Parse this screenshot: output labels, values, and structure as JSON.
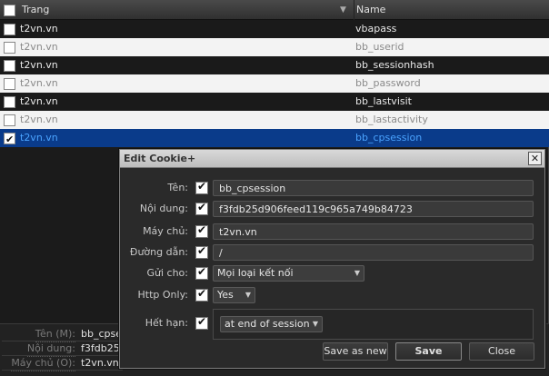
{
  "table": {
    "col_host": "Trang",
    "col_name": "Name",
    "sort_icon": "triangle-down",
    "rows": [
      {
        "host": "t2vn.vn",
        "name": "vbapass",
        "checked": false,
        "style": "dark"
      },
      {
        "host": "t2vn.vn",
        "name": "bb_userid",
        "checked": false,
        "style": "light"
      },
      {
        "host": "t2vn.vn",
        "name": "bb_sessionhash",
        "checked": false,
        "style": "dark"
      },
      {
        "host": "t2vn.vn",
        "name": "bb_password",
        "checked": false,
        "style": "light"
      },
      {
        "host": "t2vn.vn",
        "name": "bb_lastvisit",
        "checked": false,
        "style": "dark"
      },
      {
        "host": "t2vn.vn",
        "name": "bb_lastactivity",
        "checked": false,
        "style": "light"
      },
      {
        "host": "t2vn.vn",
        "name": "bb_cpsession",
        "checked": true,
        "style": "sel"
      }
    ]
  },
  "details": {
    "rows": [
      {
        "label": "Tên (M):",
        "value": "bb_cpse"
      },
      {
        "label": "Nội dung:",
        "value": "f3fdb25c"
      },
      {
        "label": "Máy chủ (O):",
        "value": "t2vn.vn"
      }
    ]
  },
  "dialog": {
    "title": "Edit Cookie+",
    "close_glyph": "✕",
    "fields": {
      "name": {
        "label": "Tên:",
        "value": "bb_cpsession"
      },
      "content": {
        "label": "Nội dung:",
        "value": "f3fdb25d906feed119c965a749b84723"
      },
      "host": {
        "label": "Máy chủ:",
        "value": "t2vn.vn"
      },
      "path": {
        "label": "Đường dẫn:",
        "value": "/"
      },
      "send_for": {
        "label": "Gửi cho:",
        "value": "Mọi loại kết nối"
      },
      "http_only": {
        "label": "Http Only:",
        "value": "Yes"
      },
      "expires": {
        "label": "Hết hạn:",
        "value": "at end of session"
      }
    },
    "buttons": {
      "save_new": "Save as new",
      "save": "Save",
      "close": "Close"
    }
  },
  "colors": {
    "selection": "#0a3b8a",
    "selected_text": "#4aa3ff",
    "background": "#181818"
  }
}
